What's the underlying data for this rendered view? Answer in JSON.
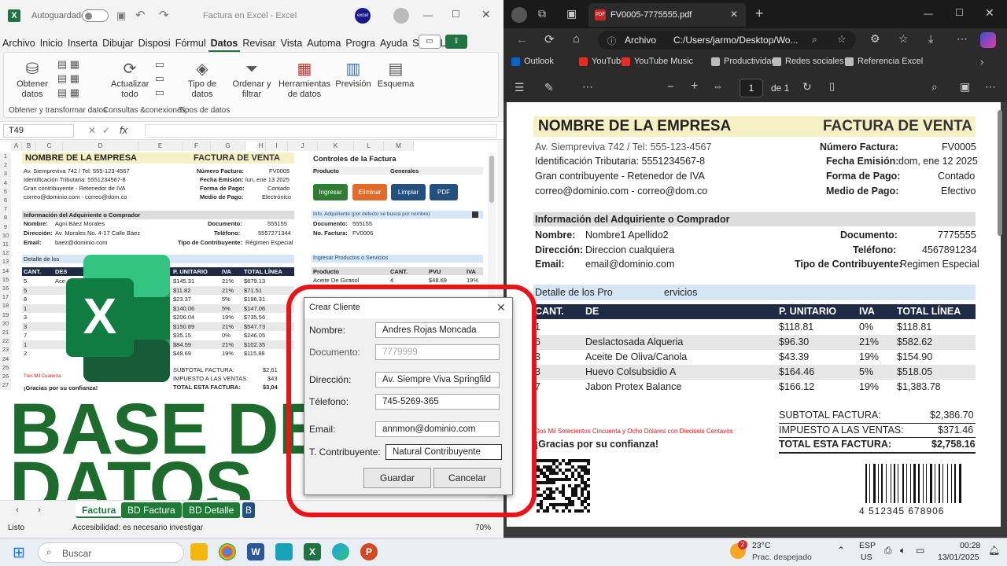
{
  "excel": {
    "autosave_label": "Autoguardado",
    "doc_title": "Factura en Excel  -  Excel",
    "logo_text": "excel",
    "tabs": [
      "Archivo",
      "Inicio",
      "Inserta",
      "Dibujar",
      "Disposi",
      "Fórmul",
      "Datos",
      "Revisar",
      "Vista",
      "Automa",
      "Progra",
      "Ayuda",
      "Script L"
    ],
    "ribbon": {
      "obtener": "Obtener\ndatos",
      "actualizar": "Actualizar\ntodo",
      "tipo": "Tipo de\ndatos",
      "ordenar": "Ordenar y\nfiltrar",
      "herramientas": "Herramientas\nde datos",
      "prevision": "Previsión",
      "esquema": "Esquema",
      "grp1": "Obtener y transformar datos",
      "grp2": "Consultas &conexiones",
      "grp3": "Tipos de datos"
    },
    "namebox": "T49",
    "fx": "fx",
    "cols": [
      "A",
      "B",
      "C",
      "D",
      "E",
      "F",
      "G",
      "H",
      "I",
      "J",
      "K",
      "L",
      "M"
    ],
    "invoice": {
      "company": "NOMBRE DE LA EMPRESA",
      "title": "FACTURA DE VENTA",
      "l1": "Av. Siempreviva 742 / Tel: 555-123-4567",
      "l2": "Identificación Tributaria: 5551234567-8",
      "l3": "Gran contribuyente - Retenedor de IVA",
      "l4": "correo@dominio.com - correo@dom.co",
      "k1": "Número Factura:",
      "v1": "FV0005",
      "k2": "Fecha Emisión:",
      "v2": "lun, ene 13 2025",
      "k3": "Forma de Pago:",
      "v3": "Contado",
      "k4": "Medio de Pago:",
      "v4": "Electrónico",
      "adq_title": "Información del Adquiriente o Comprador",
      "nombre_k": "Nombre:",
      "nombre_v": "Agni Báez Morales",
      "dir_k": "Dirección:",
      "dir_v": "Av. Morales No. 4-17 Calle Báez",
      "email_k": "Email:",
      "email_v": "baez@dominio.com",
      "doc_k": "Documento:",
      "doc_v": "555155",
      "tel_k": "Teléfono:",
      "tel_v": "5557271344",
      "tipo_k": "Tipo de Contribuyente:",
      "tipo_v": "Régimen Especial",
      "detalle": "Detalle de los",
      "hdr": [
        "CANT.",
        "DES",
        "P. UNITARIO",
        "IVA",
        "TOTAL LÍNEA"
      ],
      "rows": [
        [
          "5",
          "Ace",
          "$145.31",
          "21%",
          "$879.13"
        ],
        [
          "5",
          "",
          "$11.82",
          "21%",
          "$71.51"
        ],
        [
          "8",
          "",
          "$23.37",
          "5%",
          "$196.31"
        ],
        [
          "1",
          "",
          "$140.06",
          "5%",
          "$147.06"
        ],
        [
          "3",
          "",
          "$206.04",
          "19%",
          "$735.56"
        ],
        [
          "3",
          "",
          "$150.89",
          "21%",
          "$547.73"
        ],
        [
          "7",
          "",
          "$35.15",
          "0%",
          "$246.05"
        ],
        [
          "1",
          "",
          "$84.59",
          "21%",
          "$102.35"
        ],
        [
          "2",
          "",
          "$48.69",
          "19%",
          "$115.88"
        ]
      ],
      "sub_k": "SUBTOTAL FACTURA:",
      "sub_v": "$2,61",
      "imp_k": "IMPUESTO A LAS VENTAS:",
      "imp_v": "$43",
      "tot_k": "TOTAL ESTA FACTURA:",
      "tot_v": "$3,04",
      "letras": "Tres Mil Cuarenta",
      "gracias": "¡Gracias por su confianza!"
    },
    "controls": {
      "title": "Controles de la Factura",
      "producto_k": "Producto",
      "producto_v": "Generales",
      "btn_ingresar": "Ingresar",
      "btn_eliminar": "Eliminar",
      "btn_limpiar": "Limpiar",
      "btn_pdf": "PDF",
      "info": "Info. Adquiriente (por defecto se busca por nombre)",
      "doc_k": "Documento:",
      "doc_v": "555155",
      "fac_k": "No. Factura:",
      "fac_v": "FV0006",
      "ingresar_title": "Ingresar Productos o Servicios",
      "ph": [
        "Producto",
        "CANT.",
        "PVU",
        "IVA"
      ],
      "pr": [
        "Aceite De Girasol",
        "4",
        "$48.69",
        "19%"
      ]
    },
    "rows_nums": [
      "1",
      "2",
      "3",
      "4",
      "5",
      "6",
      "7",
      "8",
      "9",
      "10",
      "11",
      "12",
      "13",
      "14",
      "15",
      "16",
      "17",
      "18",
      "19",
      "20",
      "21",
      "22",
      "23",
      "24",
      "25",
      "26",
      "27"
    ],
    "sheet_tabs": [
      "Factura",
      "BD Factura",
      "BD Detalle",
      "B"
    ],
    "status": "Listo",
    "accesibilidad": "Accesibilidad: es necesario investigar",
    "zoom": "70%"
  },
  "overlay": {
    "line1": "BASE DE",
    "line2": "DATOS"
  },
  "dialog": {
    "title": "Crear Cliente",
    "nombre_k": "Nombre:",
    "nombre_v": "Andres Rojas Moncada",
    "doc_k": "Documento:",
    "doc_v": "7779999",
    "dir_k": "Dirección:",
    "dir_v": "Av. Siempre Viva Springfild",
    "tel_k": "Télefono:",
    "tel_v": "745-5269-365",
    "email_k": "Email:",
    "email_v": "annmon@dominio.com",
    "tc_k": "T. Contribuyente:",
    "tc_v": "Natural Contribuyente",
    "guardar": "Guardar",
    "cancelar": "Cancelar"
  },
  "edge": {
    "tab_title": "FV0005-7775555.pdf",
    "address_label": "Archivo",
    "address": "C:/Users/jarmo/Desktop/Wo...",
    "favs": [
      "Outlook",
      "YouTube",
      "YouTube Music",
      "Productividad",
      "Redes sociales",
      "Referencia Excel"
    ],
    "page_num": "1",
    "page_of": "de 1",
    "pdf": {
      "company": "NOMBRE DE LA EMPRESA",
      "title": "FACTURA DE VENTA",
      "l1": "Av. Siempreviva 742 / Tel: 555-123-4567",
      "l2": "Identificación Tributaria: 5551234567-8",
      "l3": "Gran contribuyente - Retenedor de IVA",
      "l4": "correo@dominio.com - correo@dom.co",
      "k1": "Número Factura:",
      "v1": "FV0005",
      "k2": "Fecha Emisión:",
      "v2": "dom, ene 12 2025",
      "k3": "Forma de Pago:",
      "v3": "Contado",
      "k4": "Medio de Pago:",
      "v4": "Efectivo",
      "adq_title": "Información del Adquiriente o Comprador",
      "nombre_k": "Nombre:",
      "nombre_v": "Nombre1 Apellido2",
      "dir_k": "Dirección:",
      "dir_v": "Direccion cualquiera",
      "email_k": "Email:",
      "email_v": "email@dominio.com",
      "doc_k": "Documento:",
      "doc_v": "7775555",
      "tel_k": "Teléfono:",
      "tel_v": "4567891234",
      "tipo_k": "Tipo de Contribuyente:",
      "tipo_v": "Regimen Especial",
      "detalle": "Detalle de los Pro",
      "detalle2": "ervicios",
      "hdr": [
        "CANT.",
        "DE",
        "P. UNITARIO",
        "IVA",
        "TOTAL LÍNEA"
      ],
      "rows": [
        [
          "1",
          "",
          "$118.81",
          "0%",
          "$118.81"
        ],
        [
          "6",
          "Deslactosada Alqueria",
          "$96.30",
          "21%",
          "$582.62"
        ],
        [
          "3",
          "Aceite De Oliva/Canola",
          "$43.39",
          "19%",
          "$154.90"
        ],
        [
          "3",
          "Huevo Colsubsidio A",
          "$164.46",
          "5%",
          "$518.05"
        ],
        [
          "7",
          "Jabon Protex Balance",
          "$166.12",
          "19%",
          "$1,383.78"
        ]
      ],
      "sub_k": "SUBTOTAL FACTURA:",
      "sub_v": "$2,386.70",
      "imp_k": "IMPUESTO A LAS VENTAS:",
      "imp_v": "$371.46",
      "tot_k": "TOTAL ESTA FACTURA:",
      "tot_v": "$2,758.16",
      "letras": "Dos Mil Setecientos Cincuenta y Ocho Dólares con Dieciseis Centavos",
      "gracias": "¡Gracias por su confianza!",
      "barcode": "4  512345  678906"
    }
  },
  "taskbar": {
    "search": "Buscar",
    "temp": "23°C",
    "weather": "Prac. despejado",
    "weather_badge": "2",
    "lang1": "ESP",
    "lang2": "US",
    "time": "00:28",
    "date": "13/01/2025"
  },
  "colors": {
    "excel_green": "#217346",
    "accent_red": "#e8141a",
    "header_navy": "#1f2a44",
    "title_yellow": "#f6f1c5"
  }
}
